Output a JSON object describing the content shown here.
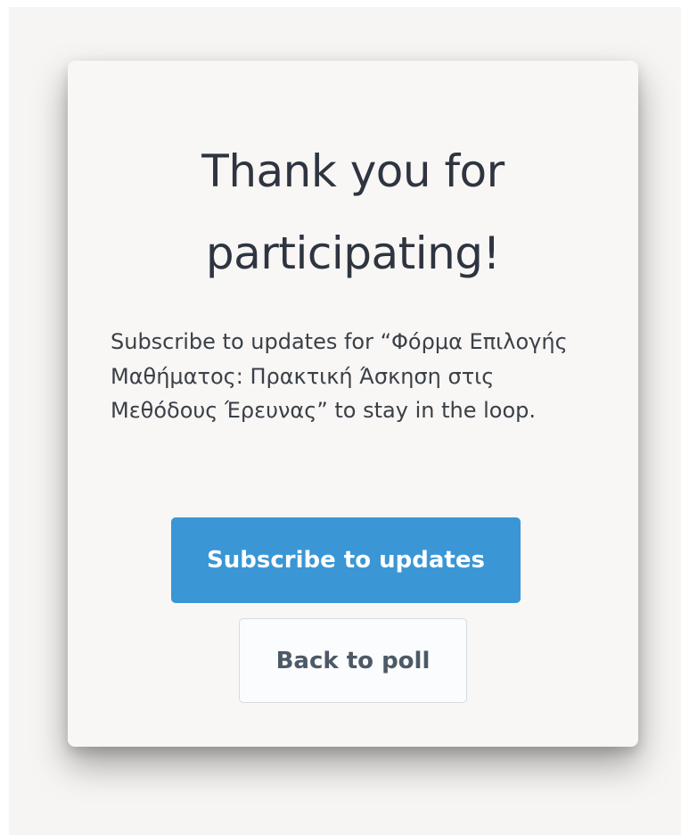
{
  "thank_you": {
    "title": "Thank you for participating!",
    "message": "Subscribe to updates for “Φόρμα Επιλογής Μαθήματος: Πρακτική Άσκηση στις Μεθόδους Έρευνας” to stay in the loop.",
    "subscribe_label": "Subscribe to updates",
    "back_label": "Back to poll"
  },
  "colors": {
    "background": "#f7f5f3",
    "card": "#f9f7f5",
    "title_text": "#2e3540",
    "body_text": "#3a4048",
    "primary_button": "#3a96d5",
    "secondary_button_text": "#4c5966"
  }
}
